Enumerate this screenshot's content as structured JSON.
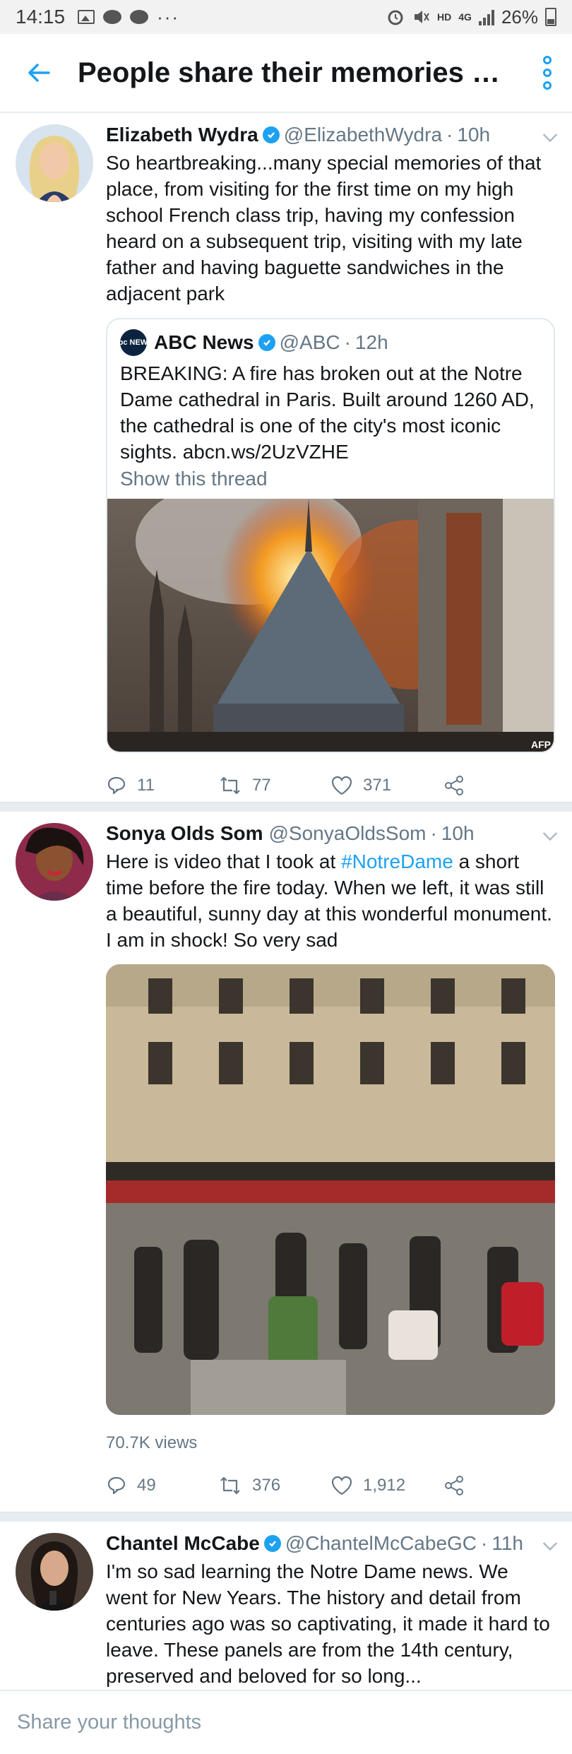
{
  "status_bar": {
    "time": "14:15",
    "more": "···",
    "hd": "HD",
    "network": "4G",
    "battery": "26%"
  },
  "header": {
    "title": "People share their memories a…",
    "back_icon": "arrow-left-icon",
    "menu_icon": "more-vertical-icon"
  },
  "tweets": [
    {
      "name": "Elizabeth Wydra",
      "handle": "@ElizabethWydra",
      "time": "10h",
      "text": "So heartbreaking...many special memories of that place, from visiting for the first time on my high school French class trip, having my confession heard on a subsequent trip, visiting with my late father and having baguette sandwiches in the adjacent park",
      "quote": {
        "name": "ABC News",
        "handle": "@ABC",
        "time": "12h",
        "logo_text": "abc NEWS",
        "text": "BREAKING: A fire has broken out at the Notre Dame cathedral in Paris. Built around 1260 AD, the cathedral is one of the city's most iconic sights. abcn.ws/2UzVZHE",
        "show_thread": "Show this thread",
        "credit": "AFP"
      },
      "replies": "11",
      "retweets": "77",
      "likes": "371"
    },
    {
      "name": "Sonya Olds Som",
      "handle": "@SonyaOldsSom",
      "time": "10h",
      "text_before": "Here is video that I took at ",
      "hashtag": "#NotreDame",
      "text_after": " a short time before the fire today. When we left, it was still a beautiful, sunny day at this wonderful monument. I am in shock! So very sad",
      "views": "70.7K views",
      "replies": "49",
      "retweets": "376",
      "likes": "1,912"
    },
    {
      "name": "Chantel McCabe",
      "handle": "@ChantelMcCabeGC",
      "time": "11h",
      "text": "I'm so sad learning the Notre Dame news. We went for New Years. The history and detail from centuries ago was so captivating, it made it hard to leave. These panels are from the 14th century, preserved and beloved for so long..."
    }
  ],
  "composer": {
    "placeholder": "Share your thoughts"
  },
  "colors": {
    "accent": "#1da1f2",
    "muted": "#657786",
    "text": "#14171a",
    "divider": "#e6ecf0"
  }
}
